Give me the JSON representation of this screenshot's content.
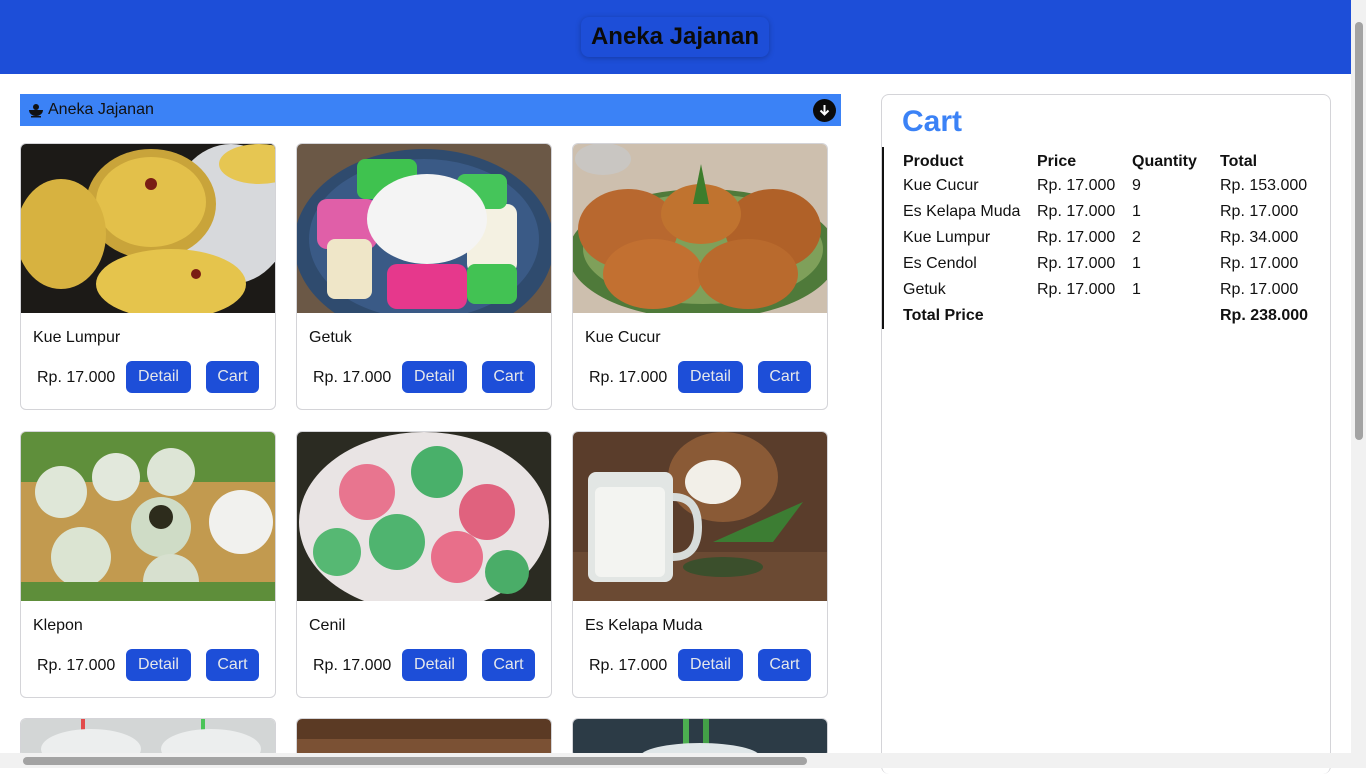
{
  "header": {
    "title": "Aneka Jajanan"
  },
  "category": {
    "label": "Aneka Jajanan",
    "icon": "bowl-icon",
    "toggle_icon": "arrow-down-circle-icon"
  },
  "products": [
    {
      "name": "Kue Lumpur",
      "price": "Rp. 17.000",
      "detail_label": "Detail",
      "cart_label": "Cart"
    },
    {
      "name": "Getuk",
      "price": "Rp. 17.000",
      "detail_label": "Detail",
      "cart_label": "Cart"
    },
    {
      "name": "Kue Cucur",
      "price": "Rp. 17.000",
      "detail_label": "Detail",
      "cart_label": "Cart"
    },
    {
      "name": "Klepon",
      "price": "Rp. 17.000",
      "detail_label": "Detail",
      "cart_label": "Cart"
    },
    {
      "name": "Cenil",
      "price": "Rp. 17.000",
      "detail_label": "Detail",
      "cart_label": "Cart"
    },
    {
      "name": "Es Kelapa Muda",
      "price": "Rp. 17.000",
      "detail_label": "Detail",
      "cart_label": "Cart"
    }
  ],
  "cart": {
    "title": "Cart",
    "columns": [
      "Product",
      "Price",
      "Quantity",
      "Total"
    ],
    "rows": [
      [
        "Kue Cucur",
        "Rp. 17.000",
        "9",
        "Rp. 153.000"
      ],
      [
        "Es Kelapa Muda",
        "Rp. 17.000",
        "1",
        "Rp. 17.000"
      ],
      [
        "Kue Lumpur",
        "Rp. 17.000",
        "2",
        "Rp. 34.000"
      ],
      [
        "Es Cendol",
        "Rp. 17.000",
        "1",
        "Rp. 17.000"
      ],
      [
        "Getuk",
        "Rp. 17.000",
        "1",
        "Rp. 17.000"
      ]
    ],
    "total_label": "Total Price",
    "total_value": "Rp. 238.000"
  },
  "colors": {
    "primary": "#1d4ed8",
    "accent": "#3b82f6"
  }
}
